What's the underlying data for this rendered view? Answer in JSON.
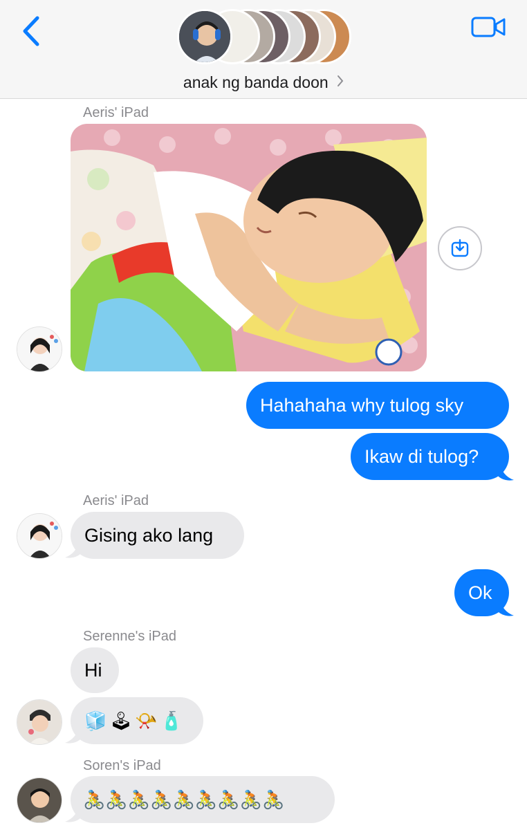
{
  "header": {
    "group_name": "anak ng banda doon",
    "back_icon": "chevron-left-icon",
    "video_icon": "video-camera-icon",
    "accent_color": "#0a7cff"
  },
  "messages": {
    "m1_sender": "Aeris' iPad",
    "m2_text": "Hahahaha why tulog sky",
    "m3_text": "Ikaw di tulog?",
    "m4_sender": "Aeris' iPad",
    "m4_text": "Gising ako lang",
    "m5_text": "Ok",
    "m6_sender": "Serenne's iPad",
    "m6_text": "Hi",
    "m7_emoji": [
      "🧊",
      "🕹",
      "📯",
      "🧴"
    ],
    "m8_sender": "Soren's iPad",
    "m8_emoji": [
      "🚴",
      "🚴",
      "🚴",
      "🚴",
      "🚴",
      "🚴",
      "🚴",
      "🚴",
      "🚴"
    ]
  },
  "colors": {
    "incoming_bubble": "#e9e9eb",
    "outgoing_bubble": "#0a7cff",
    "sender_label": "#8a8a8e"
  }
}
